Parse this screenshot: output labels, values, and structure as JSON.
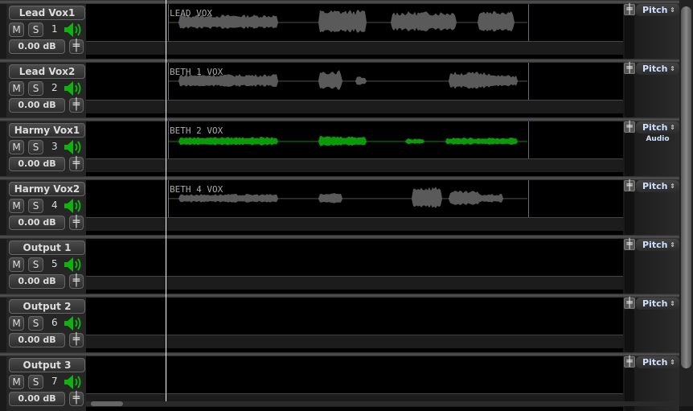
{
  "colors": {
    "waveform": "#5a5a5a",
    "selected_waveform": "#0a9a0a",
    "speaker": "#0fb20f"
  },
  "tracks": [
    {
      "name": "Lead Vox1",
      "number": "1",
      "volume": "0.00 dB",
      "mute": "M",
      "solo": "S",
      "clip": "LEAD VOX",
      "pitch": "Pitch",
      "selected": false
    },
    {
      "name": "Lead Vox2",
      "number": "2",
      "volume": "0.00 dB",
      "mute": "M",
      "solo": "S",
      "clip": "BETH 1 VOX",
      "pitch": "Pitch",
      "selected": false
    },
    {
      "name": "Harmy Vox1",
      "number": "3",
      "volume": "0.00 dB",
      "mute": "M",
      "solo": "S",
      "clip": "BETH 2 VOX",
      "pitch": "Pitch",
      "sub": "Audio",
      "selected": true
    },
    {
      "name": "Harmy Vox2",
      "number": "4",
      "volume": "0.00 dB",
      "mute": "M",
      "solo": "S",
      "clip": "BETH 4 VOX",
      "pitch": "Pitch",
      "selected": false
    },
    {
      "name": "Output 1",
      "number": "5",
      "volume": "0.00 dB",
      "mute": "M",
      "solo": "S",
      "pitch": "Pitch"
    },
    {
      "name": "Output 2",
      "number": "6",
      "volume": "0.00 dB",
      "mute": "M",
      "solo": "S",
      "pitch": "Pitch"
    },
    {
      "name": "Output 3",
      "number": "7",
      "volume": "0.00 dB",
      "mute": "M",
      "solo": "S",
      "pitch": "Pitch"
    }
  ]
}
